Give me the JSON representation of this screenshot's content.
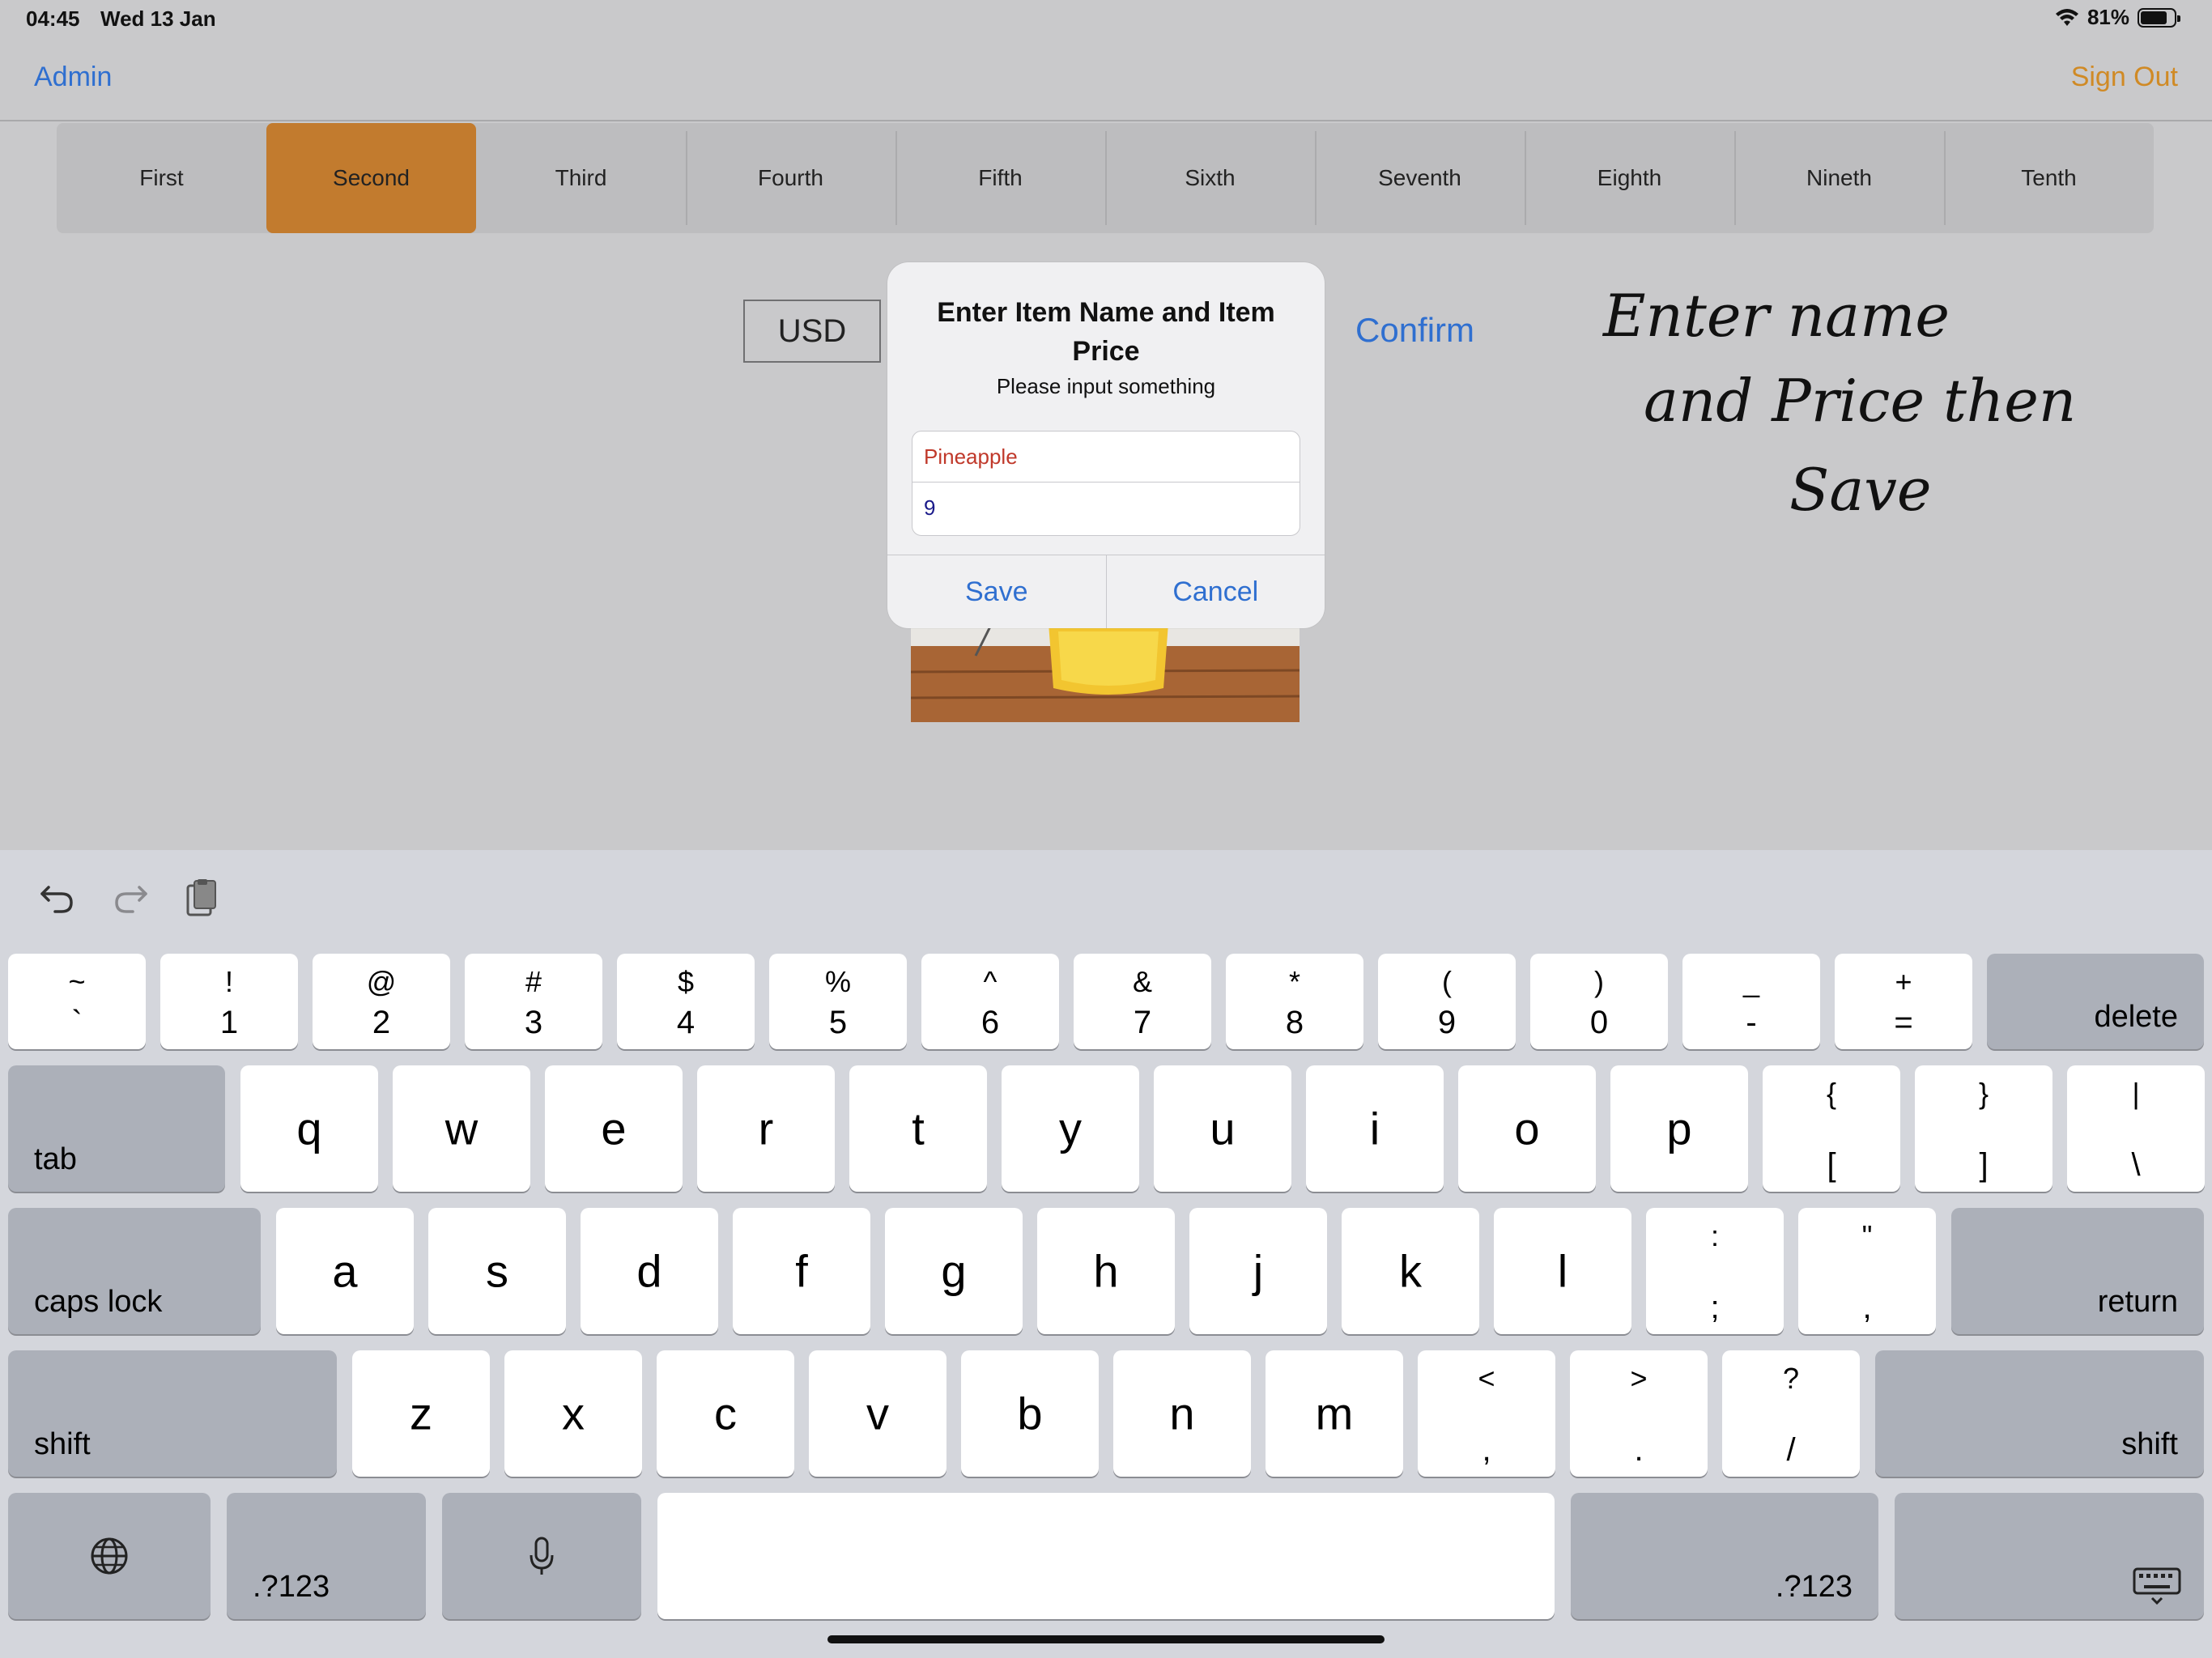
{
  "status": {
    "time": "04:45",
    "date": "Wed 13 Jan",
    "battery": "81%",
    "battery_level": 0.81
  },
  "navbar": {
    "left": "Admin",
    "right": "Sign Out"
  },
  "segments": [
    "First",
    "Second",
    "Third",
    "Fourth",
    "Fifth",
    "Sixth",
    "Seventh",
    "Eighth",
    "Nineth",
    "Tenth"
  ],
  "selected_segment": "Second",
  "currency": "USD",
  "confirm": "Confirm",
  "handwritten_note": [
    "Enter name",
    "and Price then",
    "Save"
  ],
  "alert": {
    "title": "Enter Item Name and Item Price",
    "message": "Please input something",
    "name_value": "Pineapple",
    "price_value": "9",
    "save": "Save",
    "cancel": "Cancel"
  },
  "keyboard": {
    "row1": [
      {
        "t": "~",
        "b": "`"
      },
      {
        "t": "!",
        "b": "1"
      },
      {
        "t": "@",
        "b": "2"
      },
      {
        "t": "#",
        "b": "3"
      },
      {
        "t": "$",
        "b": "4"
      },
      {
        "t": "%",
        "b": "5"
      },
      {
        "t": "^",
        "b": "6"
      },
      {
        "t": "&",
        "b": "7"
      },
      {
        "t": "*",
        "b": "8"
      },
      {
        "t": "(",
        "b": "9"
      },
      {
        "t": ")",
        "b": "0"
      },
      {
        "t": "_",
        "b": "-"
      },
      {
        "t": "+",
        "b": "="
      }
    ],
    "delete": "delete",
    "tab": "tab",
    "row2": [
      "q",
      "w",
      "e",
      "r",
      "t",
      "y",
      "u",
      "i",
      "o",
      "p"
    ],
    "row2_extra": [
      {
        "t": "{",
        "b": "["
      },
      {
        "t": "}",
        "b": "]"
      },
      {
        "t": "|",
        "b": "\\"
      }
    ],
    "caps_lock": "caps lock",
    "row3": [
      "a",
      "s",
      "d",
      "f",
      "g",
      "h",
      "j",
      "k",
      "l"
    ],
    "row3_extra": [
      {
        "t": ":",
        "b": ";"
      },
      {
        "t": "\"",
        "b": ","
      }
    ],
    "return": "return",
    "shift": "shift",
    "row4": [
      "z",
      "x",
      "c",
      "v",
      "b",
      "n",
      "m"
    ],
    "row4_extra": [
      {
        "t": "<",
        "b": ","
      },
      {
        "t": ">",
        "b": "."
      },
      {
        "t": "?",
        "b": "/"
      }
    ],
    "numbers_label": ".?123"
  }
}
